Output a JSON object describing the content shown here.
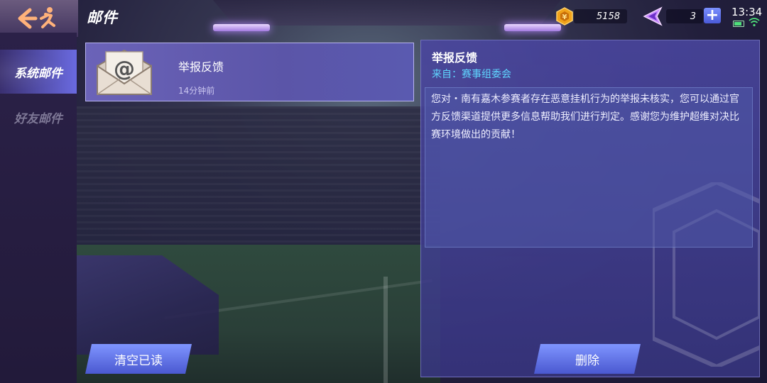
{
  "header": {
    "title": "邮件",
    "coins": "5158",
    "gems": "3",
    "plus_label": "+",
    "time": "13:34"
  },
  "sidebar": {
    "items": [
      {
        "label": "系统邮件",
        "active": true
      },
      {
        "label": "好友邮件",
        "active": false
      }
    ]
  },
  "mail_list": [
    {
      "title": "举报反馈",
      "time": "14分钟前",
      "selected": true
    }
  ],
  "detail": {
    "title": "举报反馈",
    "from": "来自：赛事组委会",
    "body": "您对・南有嘉木参赛者存在恶意挂机行为的举报未核实，您可以通过官方反馈渠道提供更多信息帮助我们进行判定。感谢您为维护超维对决比赛环境做出的贡献！"
  },
  "buttons": {
    "clear_read": "清空已读",
    "delete": "删除"
  },
  "icons": {
    "back": "back-runner-icon",
    "coin": "coin-icon",
    "gem": "gem-icon",
    "mail": "mail-envelope-icon"
  },
  "colors": {
    "accent": "#5fd6ff",
    "button": "#6677f0",
    "panel": "#4a46a0"
  }
}
